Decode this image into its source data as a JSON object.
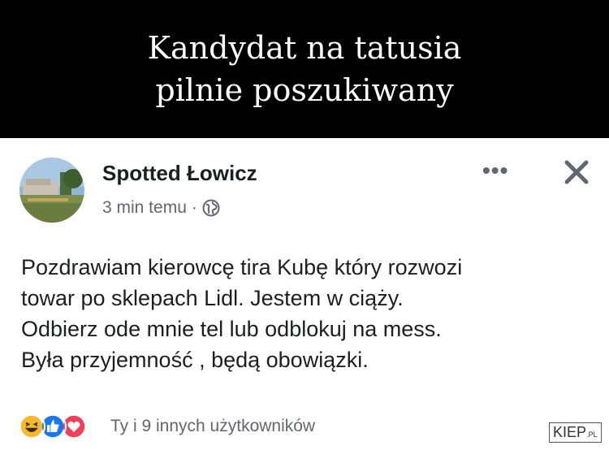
{
  "banner": {
    "line1": "Kandydat na tatusia",
    "line2": "pilnie poszukiwany"
  },
  "post": {
    "page_name": "Spotted Łowicz",
    "time": "3 min temu",
    "separator": "·",
    "privacy_icon": "globe-icon",
    "more_icon": "more-options-icon",
    "more_label": "•••",
    "close_icon": "close-icon",
    "body_lines": [
      "Pozdrawiam kierowcę tira Kubę który rozwozi",
      "towar po sklepach Lidl. Jestem w ciąży.",
      "Odbierz ode mnie tel lub odblokuj na mess.",
      "Była przyjemność , będą obowiązki."
    ],
    "reactions": {
      "icons": [
        "haha-reaction-icon",
        "like-reaction-icon",
        "love-reaction-icon"
      ],
      "text": "Ty i 9 innych użytkowników"
    }
  },
  "watermark": {
    "main": "KIEP",
    "suffix": ".PL"
  },
  "colors": {
    "banner_bg": "#000000",
    "banner_text": "#ffffff",
    "text_primary": "#1c1e21",
    "text_secondary": "#606770",
    "like_blue": "#1877f2",
    "love_red": "#f33e58",
    "haha_yellow": "#f7b928"
  }
}
